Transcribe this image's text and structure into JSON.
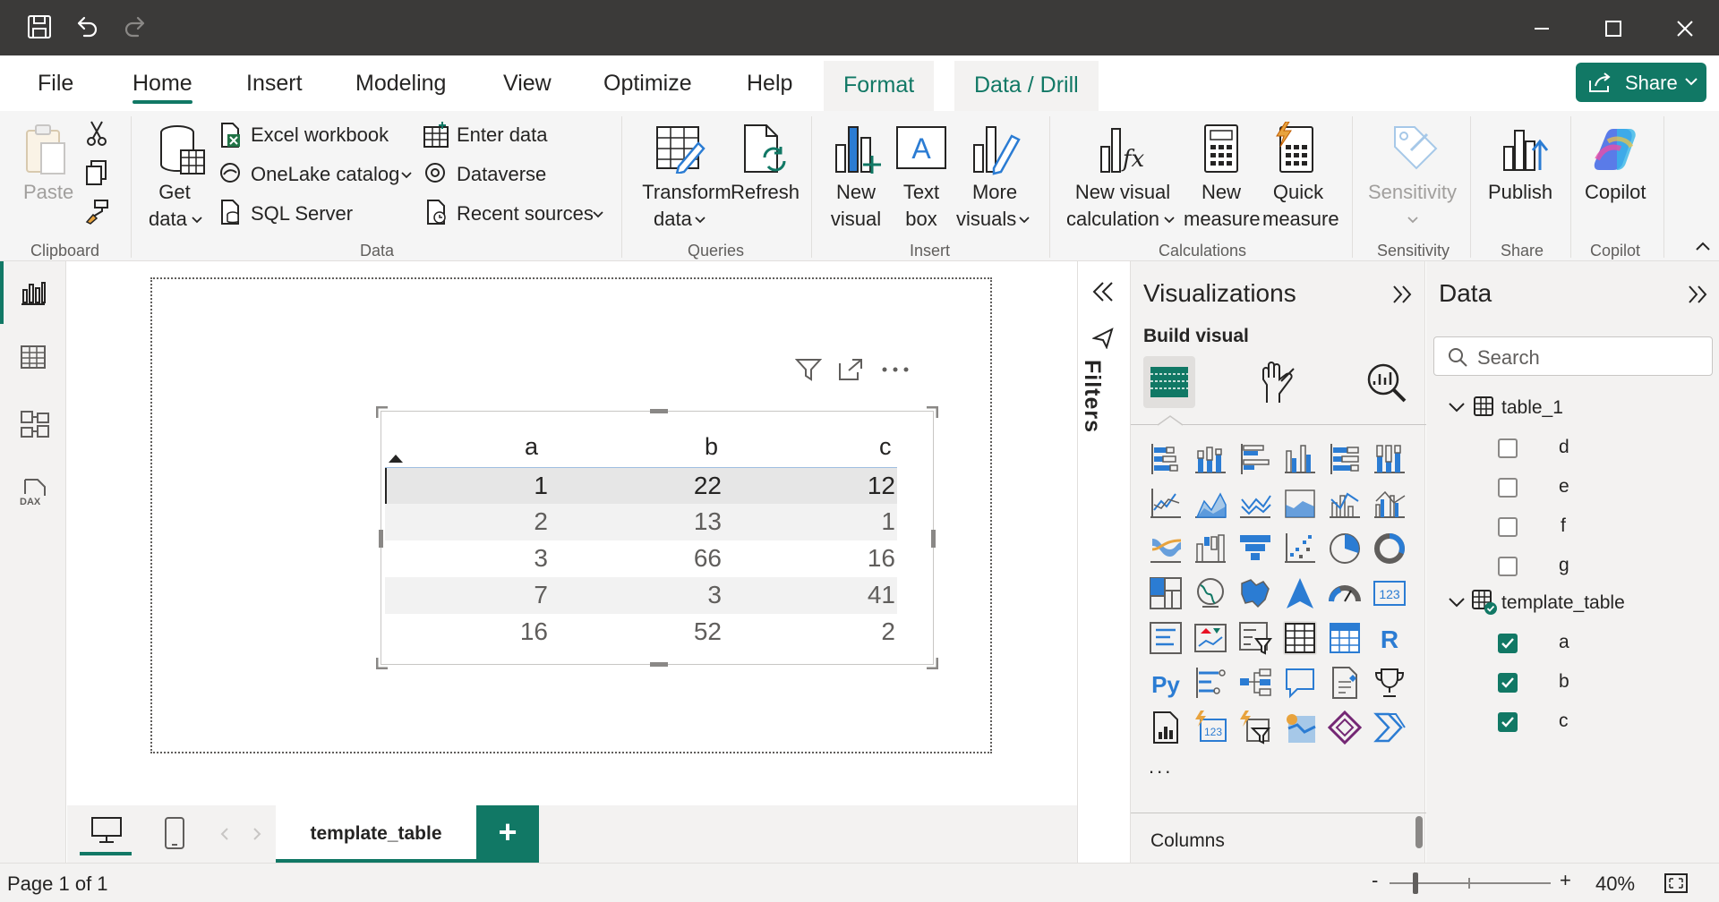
{
  "menu": {
    "tabs": [
      "File",
      "Home",
      "Insert",
      "Modeling",
      "View",
      "Optimize",
      "Help"
    ],
    "context_tabs": [
      "Format",
      "Data / Drill"
    ],
    "active_tab": "Home",
    "share_label": "Share"
  },
  "ribbon": {
    "clipboard": {
      "paste": "Paste",
      "group": "Clipboard"
    },
    "data": {
      "get_data_1": "Get",
      "get_data_2": "data",
      "excel": "Excel workbook",
      "onelake": "OneLake catalog",
      "sql": "SQL Server",
      "enter": "Enter data",
      "dataverse": "Dataverse",
      "recent": "Recent sources",
      "group": "Data"
    },
    "queries": {
      "transform_1": "Transform",
      "transform_2": "data",
      "refresh": "Refresh",
      "group": "Queries"
    },
    "insert": {
      "new_visual_1": "New",
      "new_visual_2": "visual",
      "text_box_1": "Text",
      "text_box_2": "box",
      "more_1": "More",
      "more_2": "visuals",
      "group": "Insert"
    },
    "calculations": {
      "nvc_1": "New visual",
      "nvc_2": "calculation",
      "nm_1": "New",
      "nm_2": "measure",
      "qm_1": "Quick",
      "qm_2": "measure",
      "group": "Calculations"
    },
    "sensitivity": {
      "label": "Sensitivity",
      "group": "Sensitivity"
    },
    "share": {
      "publish": "Publish",
      "group": "Share"
    },
    "copilot": {
      "label": "Copilot",
      "group": "Copilot"
    }
  },
  "table_visual": {
    "headers": [
      "a",
      "b",
      "c"
    ],
    "rows": [
      [
        "1",
        "22",
        "12"
      ],
      [
        "2",
        "13",
        "1"
      ],
      [
        "3",
        "66",
        "16"
      ],
      [
        "7",
        "3",
        "41"
      ],
      [
        "16",
        "52",
        "2"
      ]
    ]
  },
  "pages": {
    "current": "template_table",
    "add_label": "+"
  },
  "filters": {
    "label": "Filters"
  },
  "visualizations": {
    "title": "Visualizations",
    "build_visual": "Build visual",
    "columns": "Columns",
    "more": "..."
  },
  "data_pane": {
    "title": "Data",
    "search_placeholder": "Search",
    "tables": [
      {
        "name": "table_1",
        "fields": [
          "d",
          "e",
          "f",
          "g"
        ]
      },
      {
        "name": "template_table",
        "fields": [
          "a",
          "b",
          "c"
        ]
      }
    ]
  },
  "status": {
    "page": "Page 1 of 1",
    "zoom": "40%",
    "minus": "-",
    "plus": "+"
  },
  "colors": {
    "accent": "#117865",
    "titlebar": "#3b3a39",
    "viz_blue": "#2b7cd3"
  }
}
